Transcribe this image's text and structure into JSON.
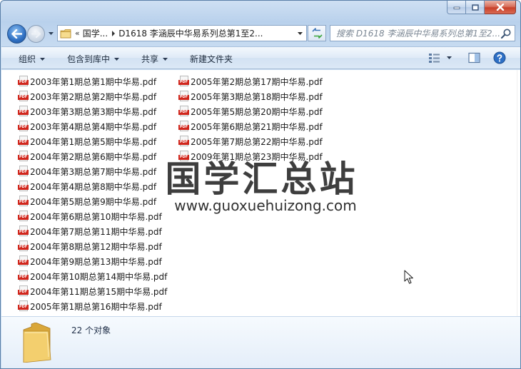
{
  "window": {
    "caption_icons": [
      "minimize-icon",
      "maximize-icon",
      "close-icon"
    ]
  },
  "address": {
    "overflow_marker": "«",
    "crumbs": [
      "国学...",
      "D1618 李涵辰中华易系列总第1至2..."
    ]
  },
  "search": {
    "placeholder": "搜索 D1618 李涵辰中华易系列总第1至2..."
  },
  "toolbar": {
    "organize": "组织",
    "include_in_library": "包含到库中",
    "share": "共享",
    "new_folder": "新建文件夹"
  },
  "files": [
    "2003年第1期总第1期中华易.pdf",
    "2003年第2期总第2期中华易.pdf",
    "2003年第3期总第3期中华易.pdf",
    "2003年第4期总第4期中华易.pdf",
    "2004年第1期总第5期中华易.pdf",
    "2004年第2期总第6期中华易.pdf",
    "2004年第3期总第7期中华易.pdf",
    "2004年第4期总第8期中华易.pdf",
    "2004年第5期总第9期中华易.pdf",
    "2004年第6期总第10期中华易.pdf",
    "2004年第7期总第11期中华易.pdf",
    "2004年第8期总第12期中华易.pdf",
    "2004年第9期总第13期中华易.pdf",
    "2004年第10期总第14期中华易.pdf",
    "2004年第11期总第15期中华易.pdf",
    "2005年第1期总第16期中华易.pdf",
    "2005年第2期总第17期中华易.pdf",
    "2005年第3期总第18期中华易.pdf",
    "2005年第5期总第20期中华易.pdf",
    "2005年第6期总第21期中华易.pdf",
    "2005年第7期总第22期中华易.pdf",
    "2009年第1期总第23期中华易.pdf"
  ],
  "file_icon_label": "PDF",
  "watermark": {
    "title": "国学汇总站",
    "url": "www.guoxuehuizong.com"
  },
  "status": {
    "count": "22 个对象"
  },
  "colors": {
    "accent": "#2e6fc2",
    "pdf_red": "#d0261c",
    "close_red": "#c8402a"
  }
}
